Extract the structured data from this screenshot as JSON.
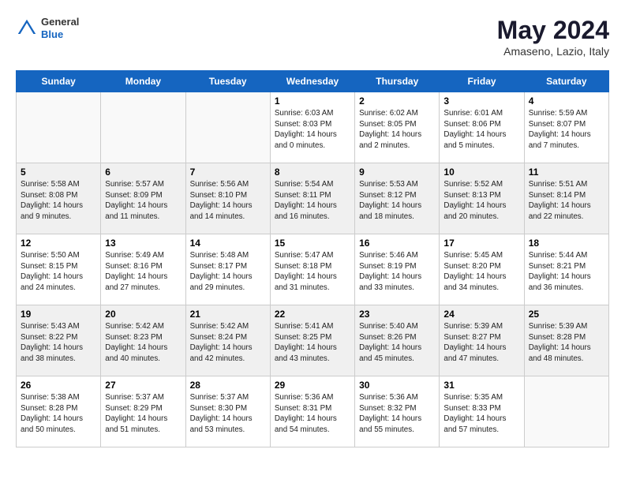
{
  "header": {
    "logo_general": "General",
    "logo_blue": "Blue",
    "main_title": "May 2024",
    "subtitle": "Amaseno, Lazio, Italy"
  },
  "calendar": {
    "days_of_week": [
      "Sunday",
      "Monday",
      "Tuesday",
      "Wednesday",
      "Thursday",
      "Friday",
      "Saturday"
    ],
    "weeks": [
      [
        {
          "day": "",
          "sunrise": "",
          "sunset": "",
          "daylight": ""
        },
        {
          "day": "",
          "sunrise": "",
          "sunset": "",
          "daylight": ""
        },
        {
          "day": "",
          "sunrise": "",
          "sunset": "",
          "daylight": ""
        },
        {
          "day": "1",
          "sunrise": "Sunrise: 6:03 AM",
          "sunset": "Sunset: 8:03 PM",
          "daylight": "Daylight: 14 hours and 0 minutes."
        },
        {
          "day": "2",
          "sunrise": "Sunrise: 6:02 AM",
          "sunset": "Sunset: 8:05 PM",
          "daylight": "Daylight: 14 hours and 2 minutes."
        },
        {
          "day": "3",
          "sunrise": "Sunrise: 6:01 AM",
          "sunset": "Sunset: 8:06 PM",
          "daylight": "Daylight: 14 hours and 5 minutes."
        },
        {
          "day": "4",
          "sunrise": "Sunrise: 5:59 AM",
          "sunset": "Sunset: 8:07 PM",
          "daylight": "Daylight: 14 hours and 7 minutes."
        }
      ],
      [
        {
          "day": "5",
          "sunrise": "Sunrise: 5:58 AM",
          "sunset": "Sunset: 8:08 PM",
          "daylight": "Daylight: 14 hours and 9 minutes."
        },
        {
          "day": "6",
          "sunrise": "Sunrise: 5:57 AM",
          "sunset": "Sunset: 8:09 PM",
          "daylight": "Daylight: 14 hours and 11 minutes."
        },
        {
          "day": "7",
          "sunrise": "Sunrise: 5:56 AM",
          "sunset": "Sunset: 8:10 PM",
          "daylight": "Daylight: 14 hours and 14 minutes."
        },
        {
          "day": "8",
          "sunrise": "Sunrise: 5:54 AM",
          "sunset": "Sunset: 8:11 PM",
          "daylight": "Daylight: 14 hours and 16 minutes."
        },
        {
          "day": "9",
          "sunrise": "Sunrise: 5:53 AM",
          "sunset": "Sunset: 8:12 PM",
          "daylight": "Daylight: 14 hours and 18 minutes."
        },
        {
          "day": "10",
          "sunrise": "Sunrise: 5:52 AM",
          "sunset": "Sunset: 8:13 PM",
          "daylight": "Daylight: 14 hours and 20 minutes."
        },
        {
          "day": "11",
          "sunrise": "Sunrise: 5:51 AM",
          "sunset": "Sunset: 8:14 PM",
          "daylight": "Daylight: 14 hours and 22 minutes."
        }
      ],
      [
        {
          "day": "12",
          "sunrise": "Sunrise: 5:50 AM",
          "sunset": "Sunset: 8:15 PM",
          "daylight": "Daylight: 14 hours and 24 minutes."
        },
        {
          "day": "13",
          "sunrise": "Sunrise: 5:49 AM",
          "sunset": "Sunset: 8:16 PM",
          "daylight": "Daylight: 14 hours and 27 minutes."
        },
        {
          "day": "14",
          "sunrise": "Sunrise: 5:48 AM",
          "sunset": "Sunset: 8:17 PM",
          "daylight": "Daylight: 14 hours and 29 minutes."
        },
        {
          "day": "15",
          "sunrise": "Sunrise: 5:47 AM",
          "sunset": "Sunset: 8:18 PM",
          "daylight": "Daylight: 14 hours and 31 minutes."
        },
        {
          "day": "16",
          "sunrise": "Sunrise: 5:46 AM",
          "sunset": "Sunset: 8:19 PM",
          "daylight": "Daylight: 14 hours and 33 minutes."
        },
        {
          "day": "17",
          "sunrise": "Sunrise: 5:45 AM",
          "sunset": "Sunset: 8:20 PM",
          "daylight": "Daylight: 14 hours and 34 minutes."
        },
        {
          "day": "18",
          "sunrise": "Sunrise: 5:44 AM",
          "sunset": "Sunset: 8:21 PM",
          "daylight": "Daylight: 14 hours and 36 minutes."
        }
      ],
      [
        {
          "day": "19",
          "sunrise": "Sunrise: 5:43 AM",
          "sunset": "Sunset: 8:22 PM",
          "daylight": "Daylight: 14 hours and 38 minutes."
        },
        {
          "day": "20",
          "sunrise": "Sunrise: 5:42 AM",
          "sunset": "Sunset: 8:23 PM",
          "daylight": "Daylight: 14 hours and 40 minutes."
        },
        {
          "day": "21",
          "sunrise": "Sunrise: 5:42 AM",
          "sunset": "Sunset: 8:24 PM",
          "daylight": "Daylight: 14 hours and 42 minutes."
        },
        {
          "day": "22",
          "sunrise": "Sunrise: 5:41 AM",
          "sunset": "Sunset: 8:25 PM",
          "daylight": "Daylight: 14 hours and 43 minutes."
        },
        {
          "day": "23",
          "sunrise": "Sunrise: 5:40 AM",
          "sunset": "Sunset: 8:26 PM",
          "daylight": "Daylight: 14 hours and 45 minutes."
        },
        {
          "day": "24",
          "sunrise": "Sunrise: 5:39 AM",
          "sunset": "Sunset: 8:27 PM",
          "daylight": "Daylight: 14 hours and 47 minutes."
        },
        {
          "day": "25",
          "sunrise": "Sunrise: 5:39 AM",
          "sunset": "Sunset: 8:28 PM",
          "daylight": "Daylight: 14 hours and 48 minutes."
        }
      ],
      [
        {
          "day": "26",
          "sunrise": "Sunrise: 5:38 AM",
          "sunset": "Sunset: 8:28 PM",
          "daylight": "Daylight: 14 hours and 50 minutes."
        },
        {
          "day": "27",
          "sunrise": "Sunrise: 5:37 AM",
          "sunset": "Sunset: 8:29 PM",
          "daylight": "Daylight: 14 hours and 51 minutes."
        },
        {
          "day": "28",
          "sunrise": "Sunrise: 5:37 AM",
          "sunset": "Sunset: 8:30 PM",
          "daylight": "Daylight: 14 hours and 53 minutes."
        },
        {
          "day": "29",
          "sunrise": "Sunrise: 5:36 AM",
          "sunset": "Sunset: 8:31 PM",
          "daylight": "Daylight: 14 hours and 54 minutes."
        },
        {
          "day": "30",
          "sunrise": "Sunrise: 5:36 AM",
          "sunset": "Sunset: 8:32 PM",
          "daylight": "Daylight: 14 hours and 55 minutes."
        },
        {
          "day": "31",
          "sunrise": "Sunrise: 5:35 AM",
          "sunset": "Sunset: 8:33 PM",
          "daylight": "Daylight: 14 hours and 57 minutes."
        },
        {
          "day": "",
          "sunrise": "",
          "sunset": "",
          "daylight": ""
        }
      ]
    ]
  }
}
